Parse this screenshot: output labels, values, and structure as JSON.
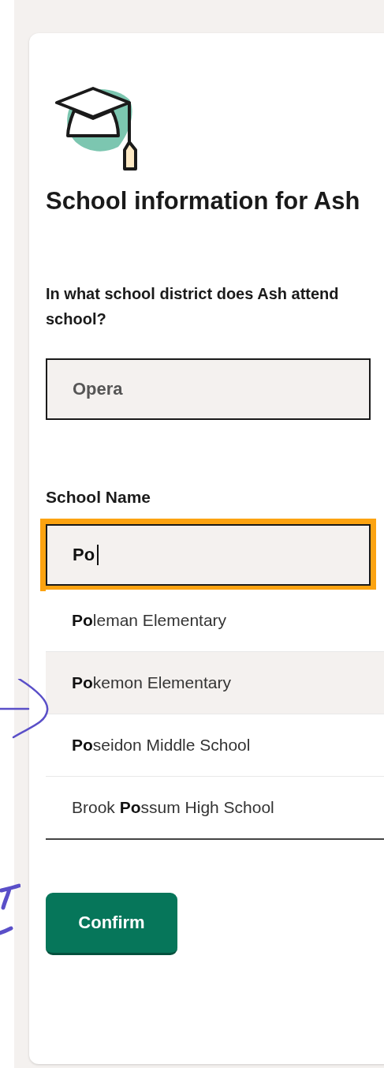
{
  "heading": "School information for Ash",
  "district": {
    "question": "In what school district does Ash attend school?",
    "value": "Opera"
  },
  "school": {
    "label": "School Name",
    "value": "Po",
    "focused": true,
    "options": [
      {
        "text": "**Po**leman Elementary",
        "selected": false
      },
      {
        "text": "**Po**kemon Elementary",
        "selected": true
      },
      {
        "text": "**Po**seidon Middle School",
        "selected": false
      },
      {
        "text": "Brook **Po**ssum High School",
        "selected": false
      }
    ]
  },
  "buttons": [
    {
      "label": "Confirm"
    }
  ]
}
